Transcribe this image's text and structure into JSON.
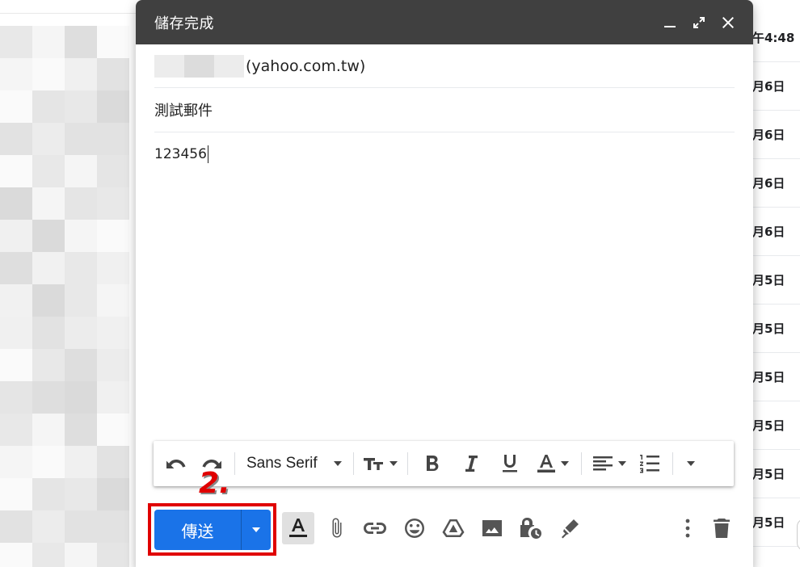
{
  "compose": {
    "title": "儲存完成",
    "to_domain": "(yahoo.com.tw)",
    "subject": "測試郵件",
    "body": "123456"
  },
  "toolbar": {
    "font": "Sans Serif",
    "icons": [
      "undo-icon",
      "redo-icon",
      "text-size-icon",
      "bold-icon",
      "italic-icon",
      "underline-icon",
      "text-color-icon",
      "align-icon",
      "numbered-list-icon",
      "more-formatting-icon"
    ]
  },
  "actions": {
    "send_label": "傳送",
    "step_label": "2.",
    "icons": [
      "formatting-options-icon",
      "attach-icon",
      "link-icon",
      "emoji-icon",
      "drive-icon",
      "photo-icon",
      "confidential-icon",
      "signature-icon",
      "more-options-icon",
      "discard-icon"
    ]
  },
  "inbox": {
    "dates": [
      "午4:48",
      "月6日",
      "月6日",
      "月6日",
      "月6日",
      "月5日",
      "月5日",
      "月5日",
      "月5日",
      "月5日",
      "月5日"
    ]
  },
  "colors": {
    "header": "#404040",
    "send": "#1a73e8",
    "annotation": "#e00000"
  }
}
